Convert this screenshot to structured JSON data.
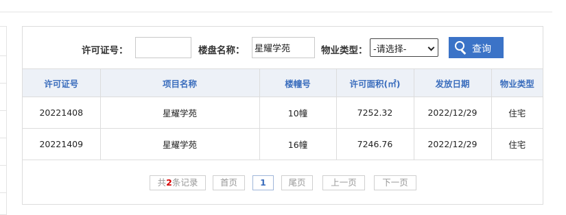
{
  "search": {
    "permit_label": "许可证号：",
    "permit_value": "",
    "project_label": "楼盘名称：",
    "project_value": "星耀学苑",
    "type_label": "物业类型：",
    "type_selected": "-请选择-",
    "button_label": "查询"
  },
  "table": {
    "headers": [
      "许可证号",
      "项目名称",
      "楼幢号",
      "许可面积(㎡)",
      "发放日期",
      "物业类型"
    ],
    "rows": [
      [
        "20221408",
        "星耀学苑",
        "10幢",
        "7252.32",
        "2022/12/29",
        "住宅"
      ],
      [
        "20221409",
        "星耀学苑",
        "16幢",
        "7246.76",
        "2022/12/29",
        "住宅"
      ]
    ]
  },
  "pager": {
    "total_prefix": "共",
    "total_count": "2",
    "total_suffix": "条记录",
    "first": "首页",
    "current_page": "1",
    "last": "尾页",
    "prev": "上一页",
    "next": "下一页"
  },
  "icons": {
    "search_button": "search-icon"
  },
  "colors": {
    "accent": "#3b73c7",
    "header_text": "#3a6dbd",
    "header_bg": "#edf1f7",
    "count": "#d40000"
  }
}
